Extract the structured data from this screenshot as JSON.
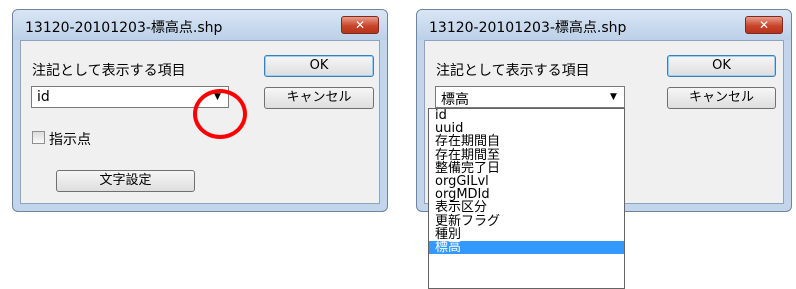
{
  "dialogs": [
    {
      "title": "13120-20101203-標高点.shp",
      "close_label": "✕",
      "field_label": "注記として表示する項目",
      "combo_value": "id",
      "ok_label": "OK",
      "cancel_label": "キャンセル",
      "checkbox_label": "指示点",
      "checkbox_checked": false,
      "text_settings_label": "文字設定"
    },
    {
      "title": "13120-20101203-標高点.shp",
      "close_label": "✕",
      "field_label": "注記として表示する項目",
      "combo_value": "標高",
      "ok_label": "OK",
      "cancel_label": "キャンセル"
    }
  ],
  "dropdown": {
    "items": [
      "id",
      "uuid",
      "存在期間自",
      "存在期間至",
      "整備完了日",
      "orgGILvl",
      "orgMDId",
      "表示区分",
      "更新フラグ",
      "種別",
      "標高"
    ],
    "selected_index": 10
  },
  "annotation": {
    "color": "#ff0000",
    "shape": "circle"
  },
  "colors": {
    "frame": "#c3d5ea",
    "close_button": "#c8462b",
    "selection": "#3399ff"
  }
}
